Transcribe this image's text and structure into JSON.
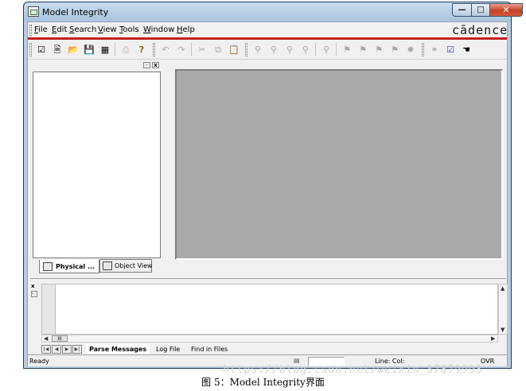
{
  "window": {
    "title": "Model Integrity"
  },
  "menu": {
    "items": [
      {
        "label": "File",
        "key": "F",
        "rest": "ile"
      },
      {
        "label": "Edit",
        "key": "E",
        "rest": "dit"
      },
      {
        "label": "Search",
        "key": "S",
        "rest": "earch"
      },
      {
        "label": "View",
        "key": "V",
        "rest": "iew"
      },
      {
        "label": "Tools",
        "key": "T",
        "rest": "ools"
      },
      {
        "label": "Window",
        "key": "W",
        "rest": "indow"
      },
      {
        "label": "Help",
        "key": "H",
        "rest": "elp"
      }
    ],
    "brand": "cādence"
  },
  "left_panel": {
    "tabs": [
      {
        "label": "Physical ...",
        "active": true
      },
      {
        "label": "Object View",
        "active": false
      }
    ]
  },
  "output_panel": {
    "tabs": [
      "Parse Messages",
      "Log File",
      "Find in Files"
    ],
    "hscroll_grip": "III"
  },
  "status": {
    "text": "Ready",
    "line_col": "Line: Col:",
    "mode": "OVR"
  },
  "caption": "图 5：Model Integrity界面",
  "watermark": "https://blog.csdn.net/weixin_37879993",
  "colors": {
    "accent_red": "#c81e1e",
    "mdi_gray": "#a9a9a9",
    "titlebar": "#b9cde0"
  }
}
